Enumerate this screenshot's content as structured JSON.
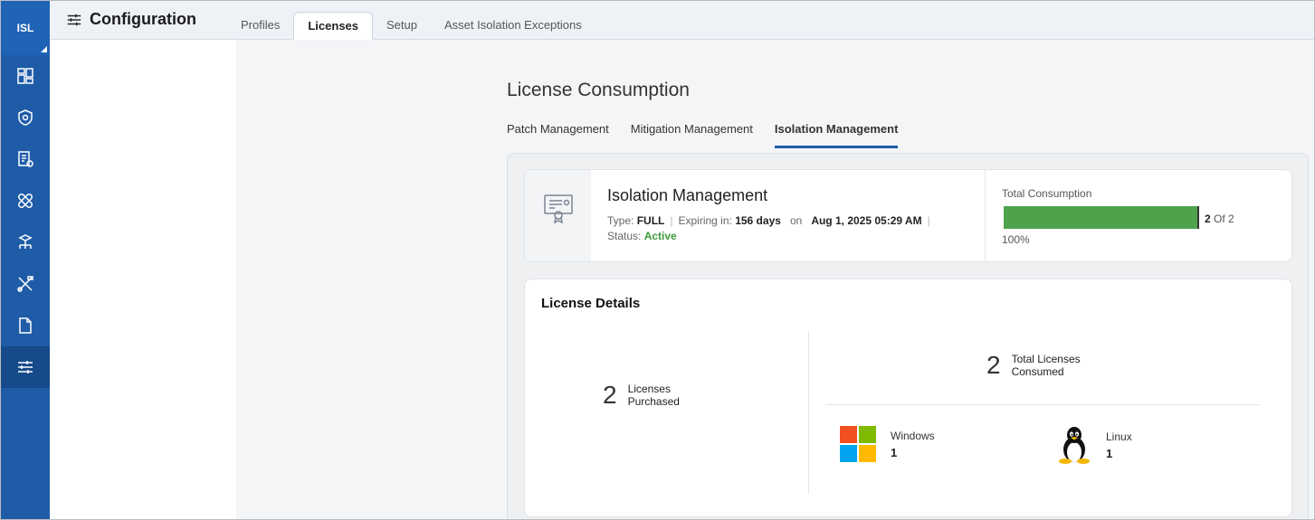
{
  "sidebar": {
    "logo": "ISL",
    "items": [
      {
        "name": "dashboard"
      },
      {
        "name": "shield"
      },
      {
        "name": "reports"
      },
      {
        "name": "bandage"
      },
      {
        "name": "network"
      },
      {
        "name": "tools"
      },
      {
        "name": "document"
      },
      {
        "name": "configuration",
        "active": true
      }
    ]
  },
  "header": {
    "title": "Configuration",
    "tabs": [
      {
        "label": "Profiles"
      },
      {
        "label": "Licenses",
        "active": true
      },
      {
        "label": "Setup"
      },
      {
        "label": "Asset Isolation Exceptions"
      }
    ]
  },
  "main": {
    "section_title": "License Consumption",
    "subtabs": [
      {
        "label": "Patch Management"
      },
      {
        "label": "Mitigation Management"
      },
      {
        "label": "Isolation Management",
        "active": true
      }
    ],
    "license": {
      "name": "Isolation Management",
      "type_label": "Type:",
      "type_value": "FULL",
      "expiring_label": "Expiring in:",
      "expiring_value": "156 days",
      "on_label": "on",
      "date_value": "Aug 1, 2025 05:29 AM",
      "status_label": "Status:",
      "status_value": "Active",
      "status_color": "#3c9a3c"
    },
    "consumption": {
      "label": "Total Consumption",
      "used": "2",
      "of_label": "Of 2",
      "percent": "100%",
      "fill_fraction": 1.0,
      "bar_color": "#4ea24c"
    },
    "details": {
      "title": "License Details",
      "purchased_count": "2",
      "purchased_label": "Licenses Purchased",
      "consumed_count": "2",
      "consumed_label": "Total Licenses Consumed",
      "os": [
        {
          "name": "Windows",
          "count": "1",
          "icon": "windows-logo-icon"
        },
        {
          "name": "Linux",
          "count": "1",
          "icon": "linux-tux-icon"
        }
      ]
    }
  },
  "colors": {
    "accent": "#1f5ca8",
    "sidebar": "#1f5ca8"
  }
}
